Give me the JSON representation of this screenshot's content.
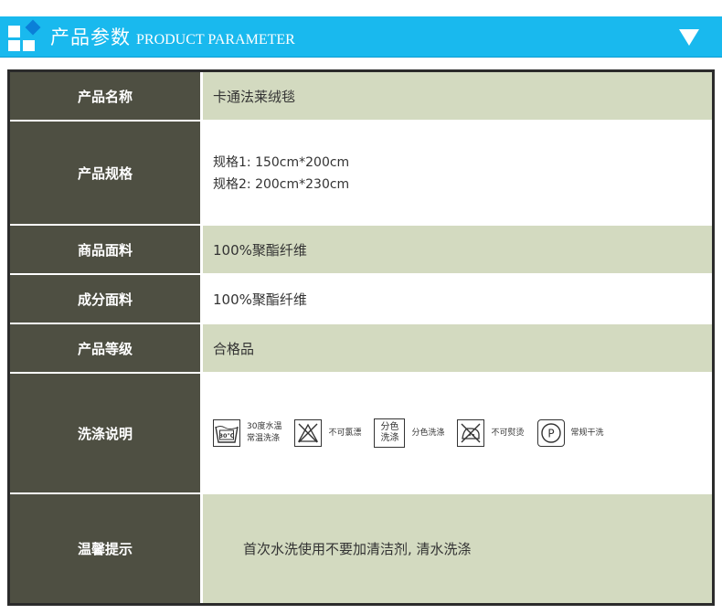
{
  "header": {
    "title_cn": "产品参数",
    "title_en": "PRODUCT PARAMETER"
  },
  "rows": [
    {
      "label": "产品名称",
      "value": "卡通法莱绒毯"
    },
    {
      "label": "产品规格",
      "lines": [
        "规格1:  150cm*200cm",
        "规格2:  200cm*230cm"
      ]
    },
    {
      "label": "商品面料",
      "value": "100%聚酯纤维"
    },
    {
      "label": "成分面料",
      "value": "100%聚酯纤维"
    },
    {
      "label": "产品等级",
      "value": "合格品"
    },
    {
      "label": "洗涤说明"
    },
    {
      "label": "温馨提示",
      "value": "首次水洗使用不要加清洁剂, 清水洗涤"
    }
  ],
  "wash": [
    {
      "icon": "wash-30-icon",
      "badge": "30℃",
      "line1": "30度水温",
      "line2": "常温洗涤"
    },
    {
      "icon": "no-bleach-icon",
      "line1": "不可氯漂"
    },
    {
      "icon": "separate-wash-icon",
      "badge1": "分色",
      "badge2": "洗涤",
      "line1": "分色洗涤"
    },
    {
      "icon": "no-iron-icon",
      "line1": "不可熨烫"
    },
    {
      "icon": "dry-clean-icon",
      "badge": "P",
      "line1": "常规干洗"
    }
  ]
}
